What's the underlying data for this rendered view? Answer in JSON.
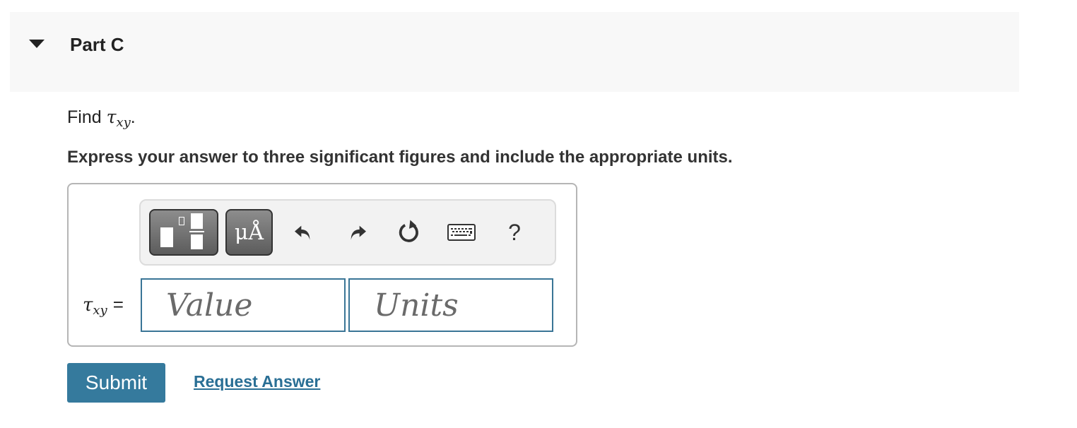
{
  "part": {
    "title": "Part C",
    "expanded": true
  },
  "question": {
    "find_prefix": "Find",
    "symbol": "τ",
    "subscript": "xy",
    "suffix": ".",
    "instruction": "Express your answer to three significant figures and include the appropriate units."
  },
  "toolbar": {
    "buttons": [
      {
        "name": "templates",
        "icon": "fraction-template-icon"
      },
      {
        "name": "units",
        "label": "μÅ",
        "icon": "units-icon"
      },
      {
        "name": "undo",
        "icon": "undo-icon"
      },
      {
        "name": "redo",
        "icon": "redo-icon"
      },
      {
        "name": "reset",
        "icon": "reset-icon"
      },
      {
        "name": "keyboard",
        "icon": "keyboard-icon"
      },
      {
        "name": "help",
        "label": "?",
        "icon": "help-icon"
      }
    ]
  },
  "answer": {
    "symbol": "τ",
    "subscript": "xy",
    "equals": "=",
    "value_placeholder": "Value",
    "value": "",
    "units_placeholder": "Units",
    "units": ""
  },
  "actions": {
    "submit_label": "Submit",
    "request_label": "Request Answer"
  },
  "colors": {
    "accent": "#357a9d",
    "link": "#2a6f95",
    "input_border": "#3a7596"
  }
}
